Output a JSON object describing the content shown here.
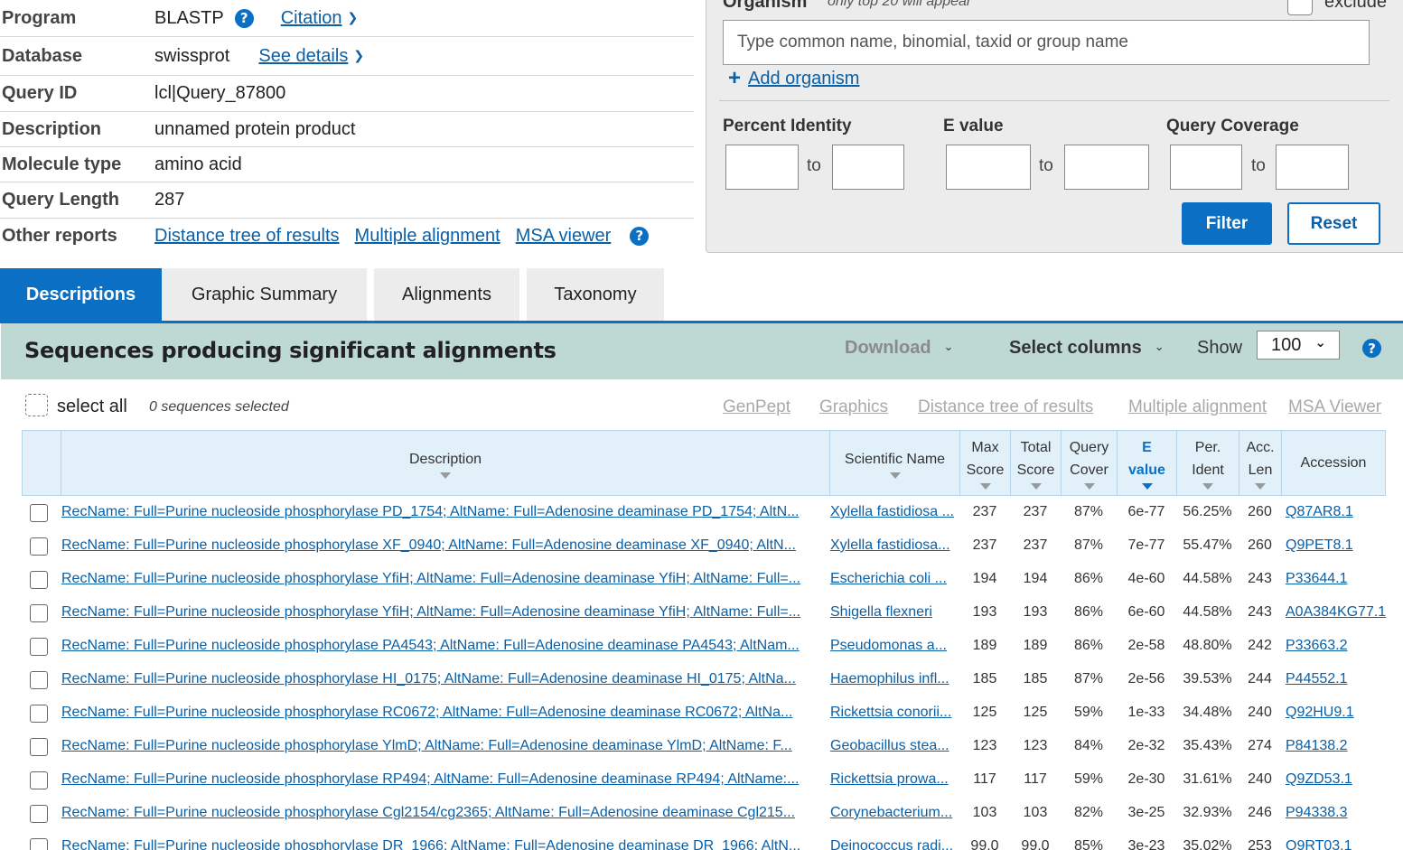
{
  "summary": {
    "program": {
      "label": "Program",
      "value": "BLASTP",
      "link": "Citation"
    },
    "database": {
      "label": "Database",
      "value": "swissprot",
      "link": "See details"
    },
    "query_id": {
      "label": "Query ID",
      "value": "lcl|Query_87800"
    },
    "description": {
      "label": "Description",
      "value": "unnamed protein product"
    },
    "molecule_type": {
      "label": "Molecule type",
      "value": "amino acid"
    },
    "query_length": {
      "label": "Query Length",
      "value": "287"
    },
    "other_reports": {
      "label": "Other reports",
      "links": [
        "Distance tree of results",
        "Multiple alignment",
        "MSA viewer"
      ]
    }
  },
  "filter": {
    "organism_label": "Organism",
    "organism_note": "only top 20 will appear",
    "exclude_label": "exclude",
    "organism_placeholder": "Type common  name, binomial, taxid or group  name",
    "add_organism": "Add organism",
    "percent_identity": "Percent Identity",
    "e_value": "E value",
    "query_coverage": "Query Coverage",
    "to": "to",
    "filter_button": "Filter",
    "reset_button": "Reset"
  },
  "tabs": [
    "Descriptions",
    "Graphic Summary",
    "Alignments",
    "Taxonomy"
  ],
  "results": {
    "title": "Sequences producing significant alignments",
    "download": "Download",
    "select_columns": "Select columns",
    "show_label": "Show",
    "show_value": "100",
    "select_all": "select all",
    "selected_count": "0 sequences selected",
    "links": [
      "GenPept",
      "Graphics",
      "Distance tree of results",
      "Multiple alignment",
      "MSA Viewer"
    ]
  },
  "columns": {
    "description": "Description",
    "scientific_name": "Scientific Name",
    "max_score": [
      "Max",
      "Score"
    ],
    "total_score": [
      "Total",
      "Score"
    ],
    "query_cover": [
      "Query",
      "Cover"
    ],
    "e_value": [
      "E",
      "value"
    ],
    "per_ident": [
      "Per.",
      "Ident"
    ],
    "acc_len": [
      "Acc.",
      "Len"
    ],
    "accession": "Accession"
  },
  "rows": [
    {
      "desc": "RecName: Full=Purine nucleoside phosphorylase PD_1754; AltName: Full=Adenosine deaminase PD_1754; AltN...",
      "sci": "Xylella fastidiosa ...",
      "max": "237",
      "total": "237",
      "cover": "87%",
      "evalue": "6e-77",
      "ident": "56.25%",
      "len": "260",
      "acc": "Q87AR8.1"
    },
    {
      "desc": "RecName: Full=Purine nucleoside phosphorylase XF_0940; AltName: Full=Adenosine deaminase XF_0940; AltN...",
      "sci": "Xylella fastidiosa...",
      "max": "237",
      "total": "237",
      "cover": "87%",
      "evalue": "7e-77",
      "ident": "55.47%",
      "len": "260",
      "acc": "Q9PET8.1"
    },
    {
      "desc": "RecName: Full=Purine nucleoside phosphorylase YfiH; AltName: Full=Adenosine deaminase YfiH; AltName: Full=...",
      "sci": "Escherichia coli ...",
      "max": "194",
      "total": "194",
      "cover": "86%",
      "evalue": "4e-60",
      "ident": "44.58%",
      "len": "243",
      "acc": "P33644.1"
    },
    {
      "desc": "RecName: Full=Purine nucleoside phosphorylase YfiH; AltName: Full=Adenosine deaminase YfiH; AltName: Full=...",
      "sci": "Shigella flexneri",
      "max": "193",
      "total": "193",
      "cover": "86%",
      "evalue": "6e-60",
      "ident": "44.58%",
      "len": "243",
      "acc": "A0A384KG77.1"
    },
    {
      "desc": "RecName: Full=Purine nucleoside phosphorylase PA4543; AltName: Full=Adenosine deaminase PA4543; AltNam...",
      "sci": "Pseudomonas a...",
      "max": "189",
      "total": "189",
      "cover": "86%",
      "evalue": "2e-58",
      "ident": "48.80%",
      "len": "242",
      "acc": "P33663.2"
    },
    {
      "desc": "RecName: Full=Purine nucleoside phosphorylase HI_0175; AltName: Full=Adenosine deaminase HI_0175; AltNa...",
      "sci": "Haemophilus infl...",
      "max": "185",
      "total": "185",
      "cover": "87%",
      "evalue": "2e-56",
      "ident": "39.53%",
      "len": "244",
      "acc": "P44552.1"
    },
    {
      "desc": "RecName: Full=Purine nucleoside phosphorylase RC0672; AltName: Full=Adenosine deaminase RC0672; AltNa...",
      "sci": "Rickettsia conorii...",
      "max": "125",
      "total": "125",
      "cover": "59%",
      "evalue": "1e-33",
      "ident": "34.48%",
      "len": "240",
      "acc": "Q92HU9.1"
    },
    {
      "desc": "RecName: Full=Purine nucleoside phosphorylase YlmD; AltName: Full=Adenosine deaminase YlmD; AltName: F...",
      "sci": "Geobacillus stea...",
      "max": "123",
      "total": "123",
      "cover": "84%",
      "evalue": "2e-32",
      "ident": "35.43%",
      "len": "274",
      "acc": "P84138.2"
    },
    {
      "desc": "RecName: Full=Purine nucleoside phosphorylase RP494; AltName: Full=Adenosine deaminase RP494; AltName:...",
      "sci": "Rickettsia prowa...",
      "max": "117",
      "total": "117",
      "cover": "59%",
      "evalue": "2e-30",
      "ident": "31.61%",
      "len": "240",
      "acc": "Q9ZD53.1"
    },
    {
      "desc": "RecName: Full=Purine nucleoside phosphorylase Cgl2154/cg2365; AltName: Full=Adenosine deaminase Cgl215...",
      "sci": "Corynebacterium...",
      "max": "103",
      "total": "103",
      "cover": "82%",
      "evalue": "3e-25",
      "ident": "32.93%",
      "len": "246",
      "acc": "P94338.3"
    },
    {
      "desc": "RecName: Full=Purine nucleoside phosphorylase DR_1966; AltName: Full=Adenosine deaminase DR_1966; AltN...",
      "sci": "Deinococcus radi...",
      "max": "99.0",
      "total": "99.0",
      "cover": "85%",
      "evalue": "3e-23",
      "ident": "35.02%",
      "len": "253",
      "acc": "Q9RT03.1"
    }
  ],
  "colors": {
    "primary": "#0b70c4",
    "link": "#0b5fa5",
    "results_bar": "#bed8d4",
    "table_header": "#e2f0fa"
  }
}
